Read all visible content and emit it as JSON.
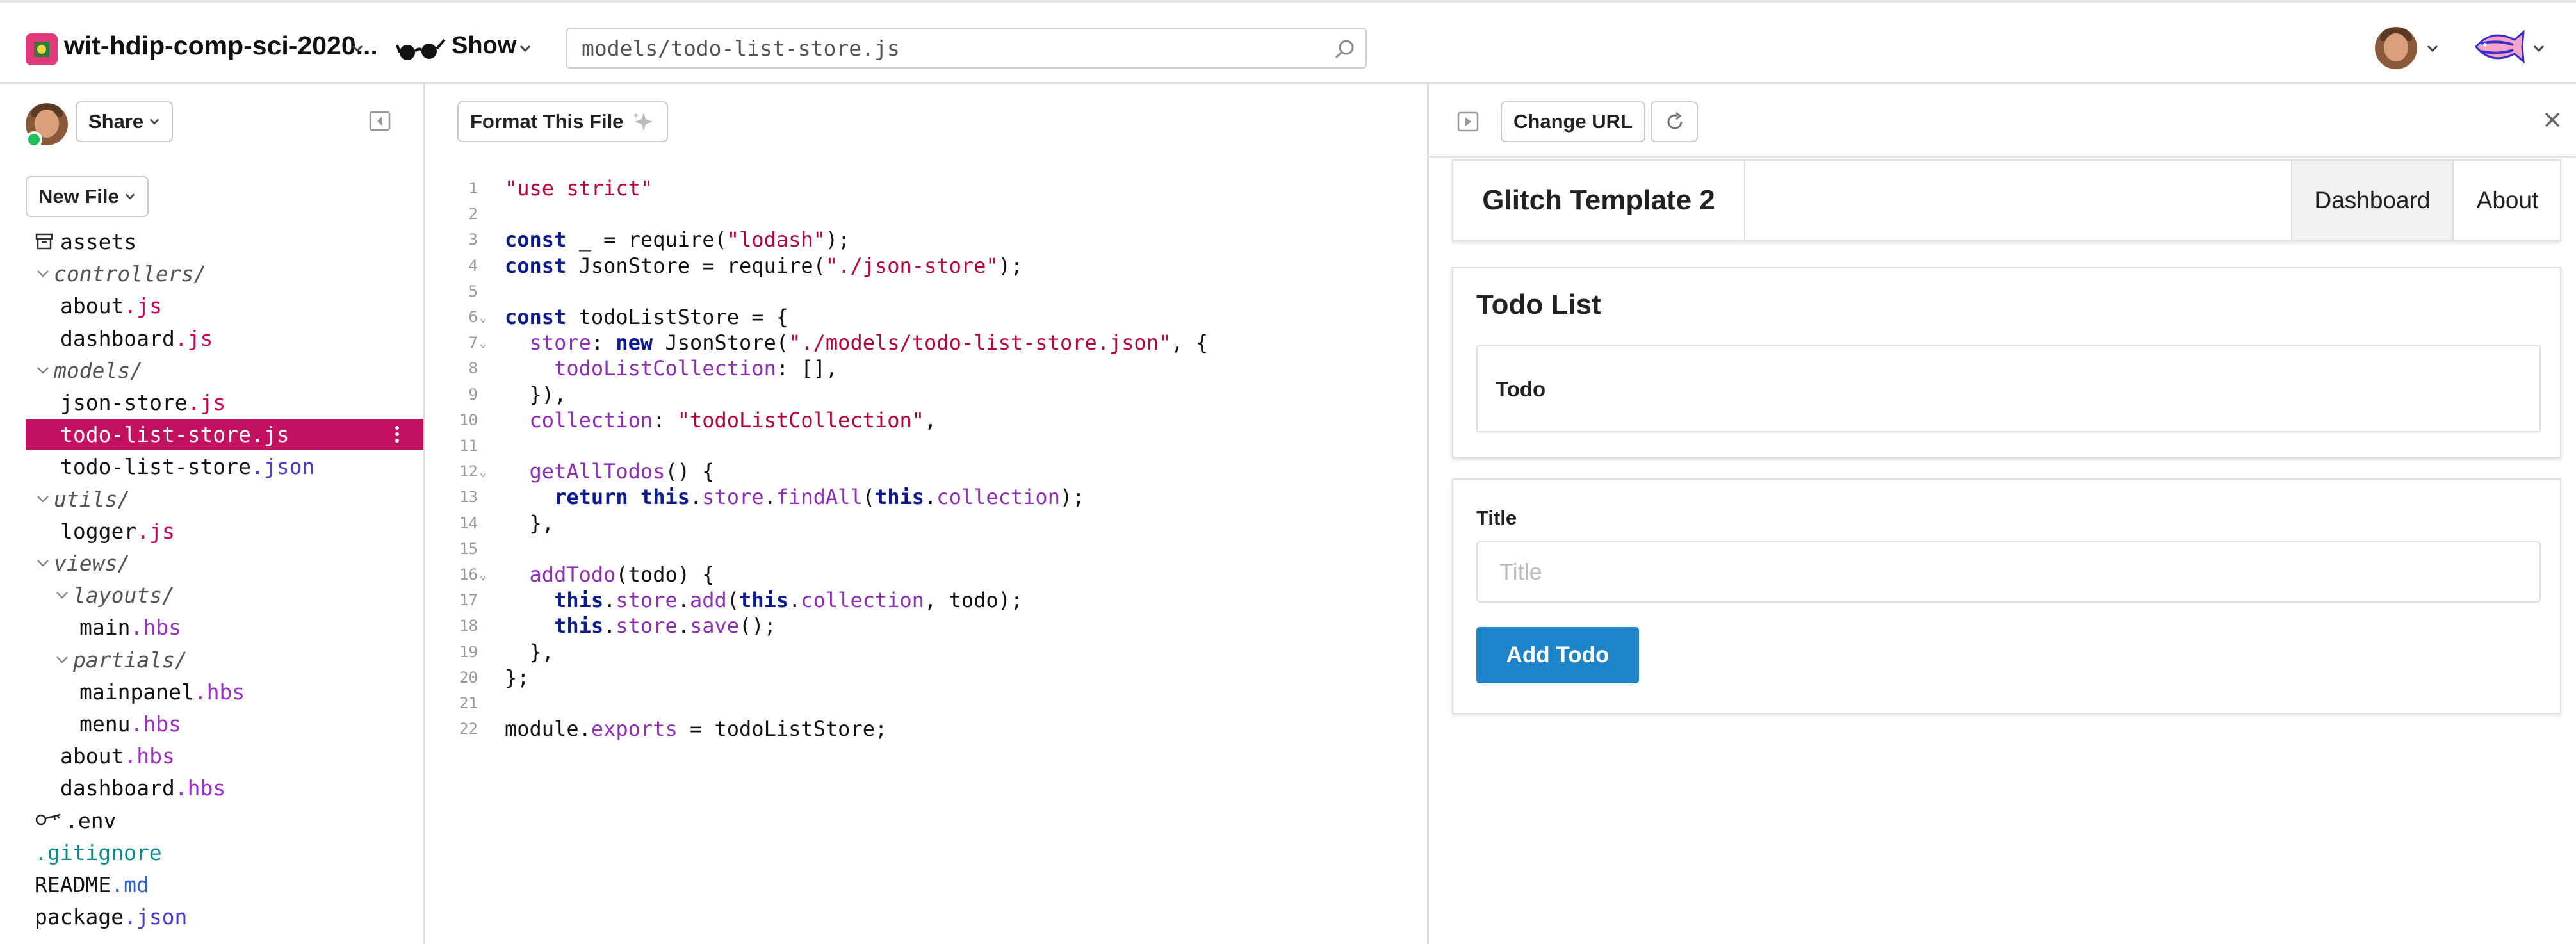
{
  "topbar": {
    "project_name": "wit-hdip-comp-sci-2020...",
    "show_label": "Show",
    "search_value": "models/todo-list-store.js"
  },
  "sidebar": {
    "share_label": "Share",
    "new_file_label": "New File",
    "tree": [
      {
        "name": "assets",
        "ext": "",
        "kind": "assets"
      },
      {
        "name": "controllers/",
        "ext": "",
        "kind": "folder"
      },
      {
        "name": "about",
        "ext": ".js",
        "kind": "file"
      },
      {
        "name": "dashboard",
        "ext": ".js",
        "kind": "file"
      },
      {
        "name": "models/",
        "ext": "",
        "kind": "folder"
      },
      {
        "name": "json-store",
        "ext": ".js",
        "kind": "file"
      },
      {
        "name": "todo-list-store",
        "ext": ".js",
        "kind": "file",
        "selected": true
      },
      {
        "name": "todo-list-store",
        "ext": ".json",
        "kind": "file"
      },
      {
        "name": "utils/",
        "ext": "",
        "kind": "folder"
      },
      {
        "name": "logger",
        "ext": ".js",
        "kind": "file"
      },
      {
        "name": "views/",
        "ext": "",
        "kind": "folder"
      },
      {
        "name": "layouts/",
        "ext": "",
        "kind": "folder"
      },
      {
        "name": "main",
        "ext": ".hbs",
        "kind": "file"
      },
      {
        "name": "partials/",
        "ext": "",
        "kind": "folder"
      },
      {
        "name": "mainpanel",
        "ext": ".hbs",
        "kind": "file"
      },
      {
        "name": "menu",
        "ext": ".hbs",
        "kind": "file"
      },
      {
        "name": "about",
        "ext": ".hbs",
        "kind": "file"
      },
      {
        "name": "dashboard",
        "ext": ".hbs",
        "kind": "file"
      },
      {
        "name": ".env",
        "ext": "",
        "kind": "env"
      },
      {
        "name": ".gitignore",
        "ext": "",
        "kind": "dotfile"
      },
      {
        "name": "README",
        "ext": ".md",
        "kind": "file"
      },
      {
        "name": "package",
        "ext": ".json",
        "kind": "file"
      }
    ]
  },
  "editor": {
    "format_label": "Format This File",
    "lines": [
      {
        "n": "1",
        "fold": false,
        "code": "<span class=\"str\">\"use strict\"</span>"
      },
      {
        "n": "2",
        "fold": false,
        "code": ""
      },
      {
        "n": "3",
        "fold": false,
        "code": "<span class=\"kw\">const</span> _ = require(<span class=\"str\">\"lodash\"</span>);"
      },
      {
        "n": "4",
        "fold": false,
        "code": "<span class=\"kw\">const</span> JsonStore = require(<span class=\"str\">\"./json-store\"</span>);"
      },
      {
        "n": "5",
        "fold": false,
        "code": ""
      },
      {
        "n": "6",
        "fold": true,
        "code": "<span class=\"kw\">const</span> todoListStore = {"
      },
      {
        "n": "7",
        "fold": true,
        "code": "  <span class=\"prop\">store</span>: <span class=\"kw\">new</span> JsonStore(<span class=\"str\">\"./models/todo-list-store.json\"</span>, {"
      },
      {
        "n": "8",
        "fold": false,
        "code": "    <span class=\"prop\">todoListCollection</span>: [],"
      },
      {
        "n": "9",
        "fold": false,
        "code": "  }),"
      },
      {
        "n": "10",
        "fold": false,
        "code": "  <span class=\"prop\">collection</span>: <span class=\"str\">\"todoListCollection\"</span>,"
      },
      {
        "n": "11",
        "fold": false,
        "code": ""
      },
      {
        "n": "12",
        "fold": true,
        "code": "  <span class=\"prop\">getAllTodos</span>() {"
      },
      {
        "n": "13",
        "fold": false,
        "code": "    <span class=\"kw\">return</span> <span class=\"kw\">this</span>.<span class=\"prop\">store</span>.<span class=\"prop\">findAll</span>(<span class=\"kw\">this</span>.<span class=\"prop\">collection</span>);"
      },
      {
        "n": "14",
        "fold": false,
        "code": "  },"
      },
      {
        "n": "15",
        "fold": false,
        "code": ""
      },
      {
        "n": "16",
        "fold": true,
        "code": "  <span class=\"prop\">addTodo</span>(todo) {"
      },
      {
        "n": "17",
        "fold": false,
        "code": "    <span class=\"kw\">this</span>.<span class=\"prop\">store</span>.<span class=\"prop\">add</span>(<span class=\"kw\">this</span>.<span class=\"prop\">collection</span>, todo);"
      },
      {
        "n": "18",
        "fold": false,
        "code": "    <span class=\"kw\">this</span>.<span class=\"prop\">store</span>.<span class=\"prop\">save</span>();"
      },
      {
        "n": "19",
        "fold": false,
        "code": "  },"
      },
      {
        "n": "20",
        "fold": false,
        "code": "};"
      },
      {
        "n": "21",
        "fold": false,
        "code": ""
      },
      {
        "n": "22",
        "fold": false,
        "code": "module.<span class=\"prop\">exports</span> = todoListStore;"
      }
    ]
  },
  "preview": {
    "change_url_label": "Change URL",
    "app": {
      "brand": "Glitch Template 2",
      "nav": {
        "dashboard": "Dashboard",
        "about": "About"
      },
      "todo_card": {
        "title": "Todo List",
        "header": "Todo"
      },
      "form": {
        "label": "Title",
        "placeholder": "Title",
        "button": "Add Todo"
      }
    }
  },
  "colors": {
    "selected": "#c2125f",
    "js_ext": "#c8005c",
    "json_ext": "#4b3ecb",
    "hbs_ext": "#9b2fc8",
    "add_button": "#1f83c8",
    "online": "#1fbf5a"
  }
}
